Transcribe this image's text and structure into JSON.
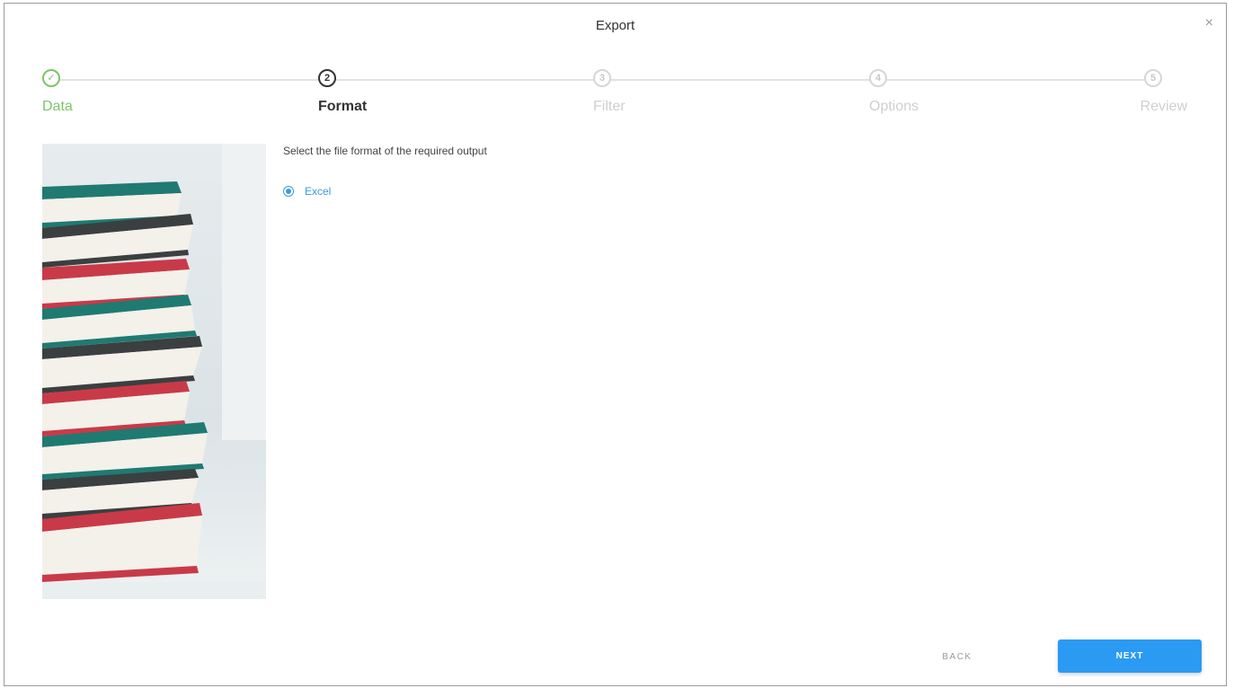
{
  "dialog": {
    "title": "Export",
    "close_icon": "×"
  },
  "stepper": {
    "steps": [
      {
        "number": "✓",
        "label": "Data",
        "state": "done"
      },
      {
        "number": "2",
        "label": "Format",
        "state": "active"
      },
      {
        "number": "3",
        "label": "Filter",
        "state": "pending"
      },
      {
        "number": "4",
        "label": "Options",
        "state": "pending"
      },
      {
        "number": "5",
        "label": "Review",
        "state": "pending"
      }
    ]
  },
  "content": {
    "instruction": "Select the file format of the required output",
    "format_options": [
      {
        "label": "Excel",
        "selected": true
      }
    ]
  },
  "footer": {
    "back_label": "BACK",
    "next_label": "NEXT"
  },
  "colors": {
    "done_green": "#7cc46b",
    "primary_blue": "#2b9af3",
    "link_blue": "#3a9ad9",
    "book_teal": "#1f7a72",
    "book_red": "#c93a48",
    "book_dark": "#3b3f40"
  },
  "icons": {
    "close": "close-icon",
    "step_done": "check-circle-icon",
    "radio": "radio-selected-icon"
  }
}
